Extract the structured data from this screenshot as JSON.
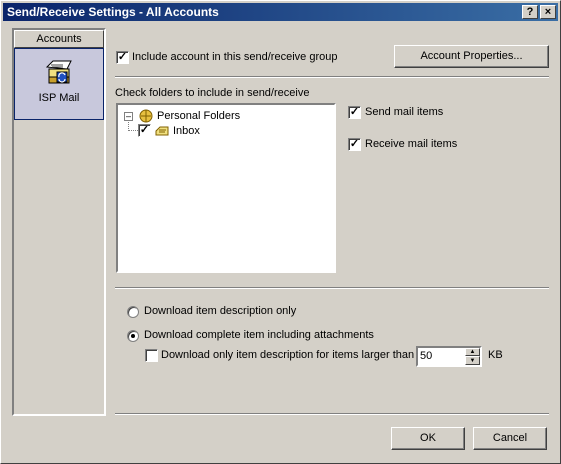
{
  "window": {
    "title": "Send/Receive Settings - All Accounts",
    "help_glyph": "?",
    "close_glyph": "×"
  },
  "sidebar": {
    "header": "Accounts",
    "items": [
      {
        "label": "ISP Mail",
        "icon": "mail-account-icon",
        "selected": true
      }
    ]
  },
  "account": {
    "include_label": "Include account in this send/receive group",
    "include_checked": true,
    "properties_button": "Account Properties..."
  },
  "folders": {
    "section_label": "Check folders to include in send/receive",
    "tree": [
      {
        "label": "Personal Folders",
        "expander": "⊟",
        "checked": null
      },
      {
        "label": "Inbox",
        "checked": true
      }
    ]
  },
  "options": {
    "send_label": "Send mail items",
    "send_checked": true,
    "receive_label": "Receive mail items",
    "receive_checked": true
  },
  "download": {
    "header_only_label": "Download item description only",
    "complete_label": "Download complete item including attachments",
    "selected": "complete",
    "limit_label": "Download only item description for items larger than",
    "limit_checked": false,
    "limit_value": "50",
    "limit_unit": "KB"
  },
  "footer": {
    "ok": "OK",
    "cancel": "Cancel"
  },
  "glyphs": {
    "check": "✓",
    "spin_up": "▲",
    "spin_down": "▼"
  }
}
